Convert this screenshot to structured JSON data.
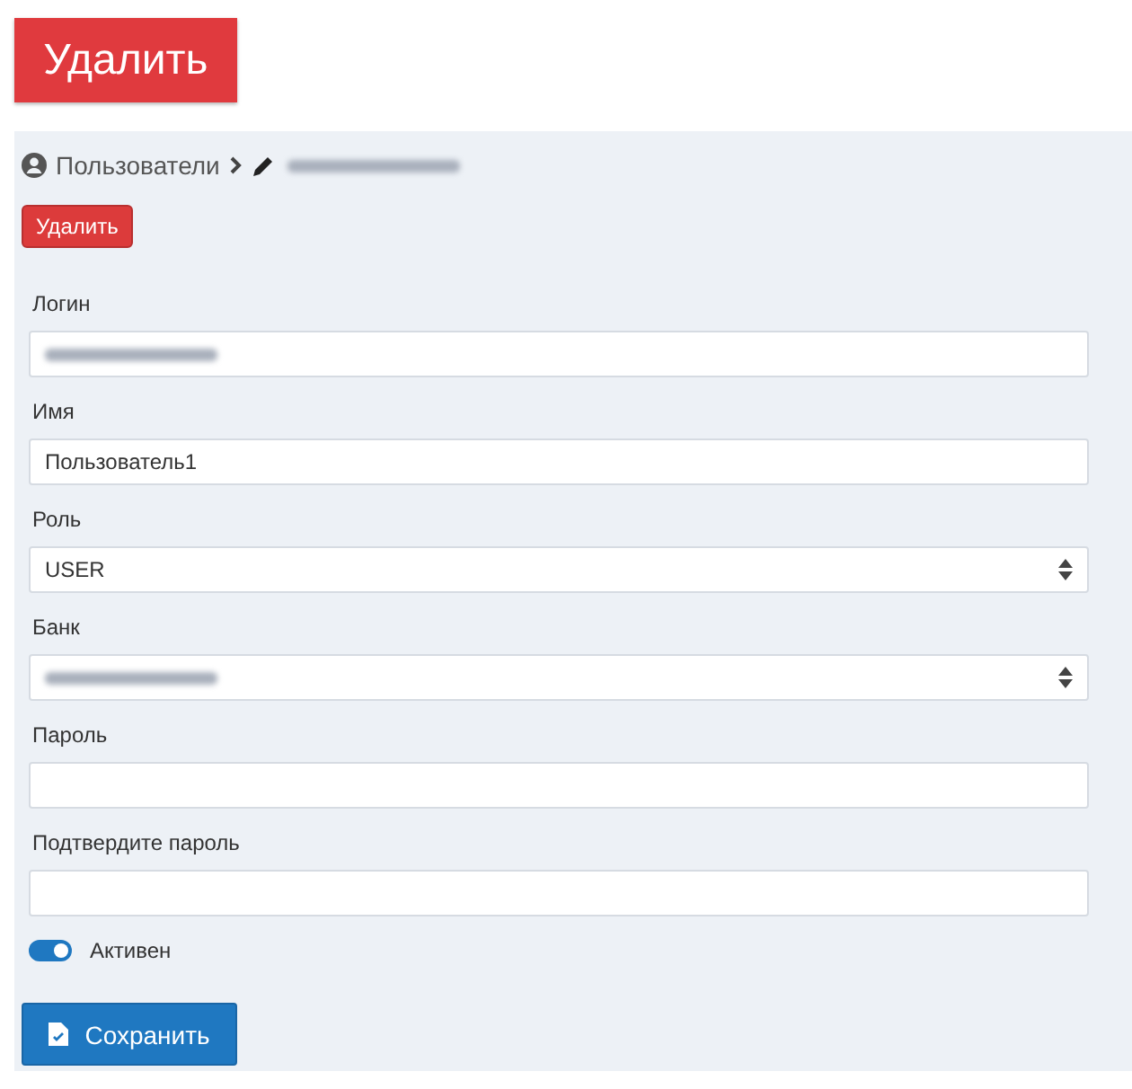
{
  "header_button": "Удалить",
  "breadcrumb": {
    "parent": "Пользователи",
    "current_redacted": true
  },
  "delete_button": "Удалить",
  "fields": [
    {
      "label": "Логин",
      "kind": "text",
      "redacted": true
    },
    {
      "label": "Имя",
      "kind": "text",
      "value": "Пользователь1"
    },
    {
      "label": "Роль",
      "kind": "select",
      "value": "USER"
    },
    {
      "label": "Банк",
      "kind": "select",
      "redacted": true
    },
    {
      "label": "Пароль",
      "kind": "password"
    },
    {
      "label": "Подтвердите пароль",
      "kind": "password"
    }
  ],
  "active": {
    "label": "Активен",
    "on": true
  },
  "save_button": "Сохранить"
}
